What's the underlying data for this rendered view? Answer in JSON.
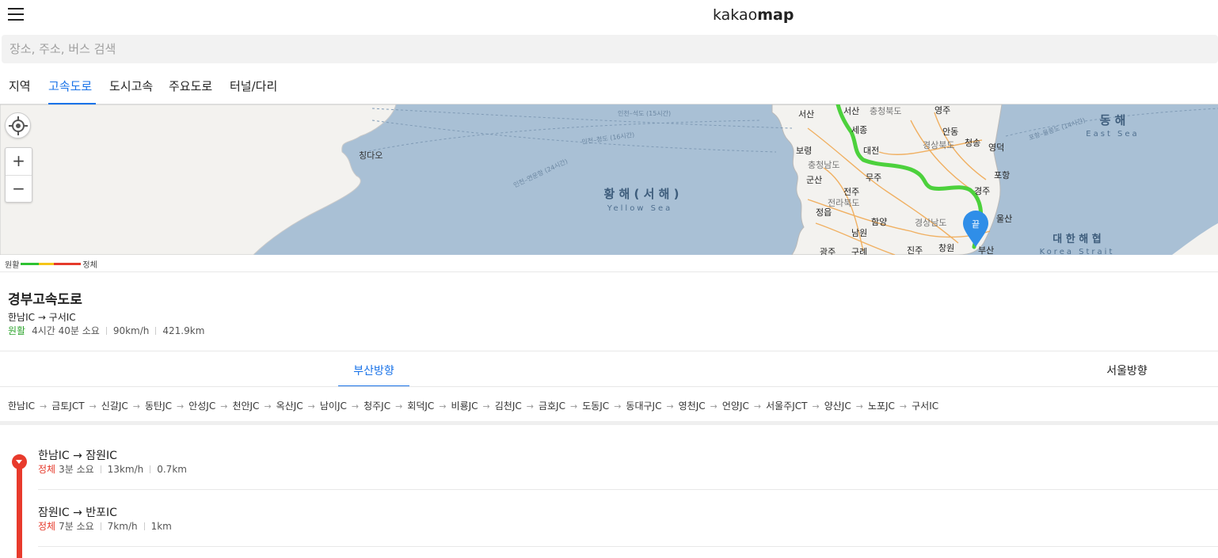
{
  "header": {
    "menu_icon": "hamburger-icon",
    "logo_light": "kakao",
    "logo_bold": "map"
  },
  "search": {
    "placeholder": "장소, 주소, 버스 검색"
  },
  "tabs": [
    "지역",
    "고속도로",
    "도시고속",
    "주요도로",
    "터널/다리"
  ],
  "active_tab": "고속도로",
  "map": {
    "labels": {
      "yellow_sea_ko": "황 해 ( 서 해 )",
      "yellow_sea_en": "Yellow Sea",
      "east_sea_ko": "동 해",
      "east_sea_en": "East Sea",
      "korea_strait_ko": "대 한 해 협",
      "korea_strait_en": "Korea Strait",
      "qingdao": "칭다오",
      "end_marker": "끝",
      "route1": "인천–석도 (15시간)",
      "route2": "인천–청도 (16시간)",
      "route3": "인천–연운항 (24시간)",
      "route4": "포항–울릉도 (14시간)",
      "cities": [
        "서산",
        "서산",
        "충청북도",
        "영주",
        "세종",
        "안동",
        "보령",
        "대전",
        "경상북도",
        "청송",
        "영덕",
        "충청남도",
        "군산",
        "전주",
        "무주",
        "포항",
        "전라북도",
        "경주",
        "정읍",
        "함양",
        "울산",
        "남원",
        "경상남도",
        "광주",
        "구례",
        "진주",
        "창원",
        "부산"
      ]
    },
    "controls": {
      "locate_icon": "locate-icon",
      "zoom_in": "+",
      "zoom_out": "−"
    },
    "legend": {
      "left": "원활",
      "right": "정체"
    }
  },
  "road": {
    "name": "경부고속도로",
    "section": "한남IC → 구서IC",
    "status": "원활",
    "time": "4시간 40분 소요",
    "speed": "90km/h",
    "distance": "421.9km"
  },
  "directions": [
    "부산방향",
    "서울방향"
  ],
  "active_direction": "부산방향",
  "interchanges": [
    "한남IC",
    "금토JCT",
    "신갈JC",
    "동탄JC",
    "안성JC",
    "천안JC",
    "옥산JC",
    "남이JC",
    "청주JC",
    "회덕JC",
    "비룡JC",
    "김천JC",
    "금호JC",
    "도동JC",
    "동대구JC",
    "영천JC",
    "언양JC",
    "서울주JCT",
    "양산JC",
    "노포JC",
    "구서IC"
  ],
  "segments": [
    {
      "title": "한남IC → 잠원IC",
      "status": "정체",
      "time": "3분 소요",
      "speed": "13km/h",
      "distance": "0.7km"
    },
    {
      "title": "잠원IC → 반포IC",
      "status": "정체",
      "time": "7분 소요",
      "speed": "7km/h",
      "distance": "1km"
    }
  ],
  "colors": {
    "accent": "#1a73e8",
    "smooth": "#2ea42e",
    "congested": "#e53a2b",
    "route": "#4cd13c"
  }
}
